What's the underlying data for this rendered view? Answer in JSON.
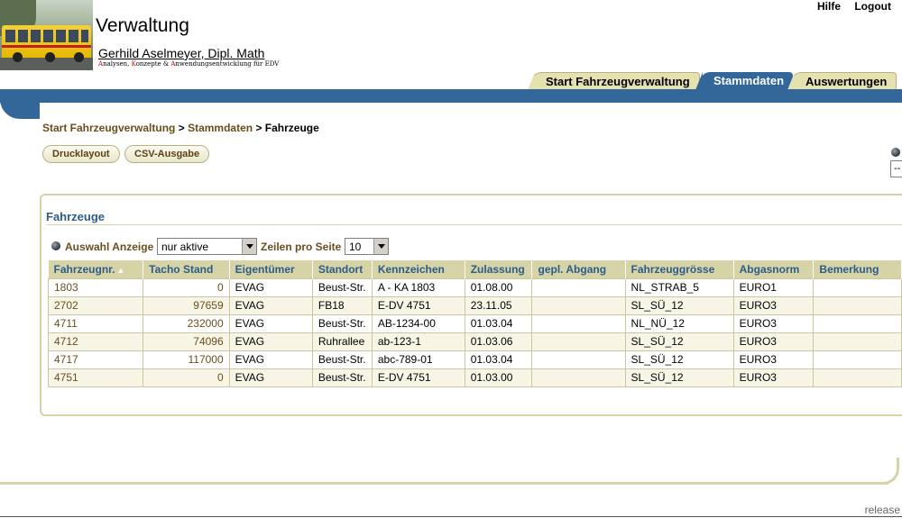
{
  "header": {
    "title": "Verwaltung",
    "subtitle": "Gerhild Aselmeyer, Dipl. Math",
    "tagline": {
      "p1": "A",
      "p2": "nalysen, ",
      "p3": "K",
      "p4": "onzepte & ",
      "p5": "A",
      "p6": "nwendungsentwicklung für EDV"
    },
    "links": {
      "help": "Hilfe",
      "logout": "Logout"
    }
  },
  "tabs": [
    {
      "label": "Start Fahrzeugverwaltung",
      "active": false
    },
    {
      "label": "Stammdaten",
      "active": true
    },
    {
      "label": "Auswertungen",
      "active": false
    }
  ],
  "breadcrumb": {
    "level1": "Start Fahrzeugverwaltung",
    "sep": ">",
    "level2": "Stammdaten",
    "current": "Fahrzeuge"
  },
  "buttons": {
    "print": "Drucklayout",
    "csv": "CSV-Ausgabe"
  },
  "right_select_value": "--",
  "panel": {
    "title": "Fahrzeuge",
    "filter": {
      "label": "Auswahl Anzeige",
      "value": "nur aktive",
      "rows_label": "Zeilen pro Seite",
      "rows_value": "10"
    }
  },
  "table": {
    "columns": [
      "Fahrzeugnr.",
      "Tacho Stand",
      "Eigentümer",
      "Standort",
      "Kennzeichen",
      "Zulassung",
      "gepl. Abgang",
      "Fahrzeuggrösse",
      "Abgasnorm",
      "Bemerkung"
    ],
    "sort_icon": "sort-ascending-icon",
    "rows": [
      [
        "1803",
        "0",
        "EVAG",
        "Beust-Str.",
        "A - KA 1803",
        "01.08.00",
        "",
        "NL_STRAB_5",
        "EURO1",
        ""
      ],
      [
        "2702",
        "97659",
        "EVAG",
        "FB18",
        "E-DV 4751",
        "23.11.05",
        "",
        "SL_SÜ_12",
        "EURO3",
        ""
      ],
      [
        "4711",
        "232000",
        "EVAG",
        "Beust-Str.",
        "AB-1234-00",
        "01.03.04",
        "",
        "NL_NÜ_12",
        "EURO3",
        ""
      ],
      [
        "4712",
        "74096",
        "EVAG",
        "Ruhrallee",
        "ab-123-1",
        "01.03.06",
        "",
        "SL_SÜ_12",
        "EURO3",
        ""
      ],
      [
        "4717",
        "117000",
        "EVAG",
        "Beust-Str.",
        "abc-789-01",
        "01.03.04",
        "",
        "SL_SÜ_12",
        "EURO3",
        ""
      ],
      [
        "4751",
        "0",
        "EVAG",
        "Beust-Str.",
        "E-DV 4751",
        "01.03.00",
        "",
        "SL_SÜ_12",
        "EURO3",
        ""
      ]
    ]
  },
  "footer": {
    "release": "release"
  },
  "colors": {
    "brand_blue": "#336699",
    "khaki": "#d6d3a7",
    "link_brown": "#6b4d1e",
    "header_text": "#2b5c8a"
  }
}
